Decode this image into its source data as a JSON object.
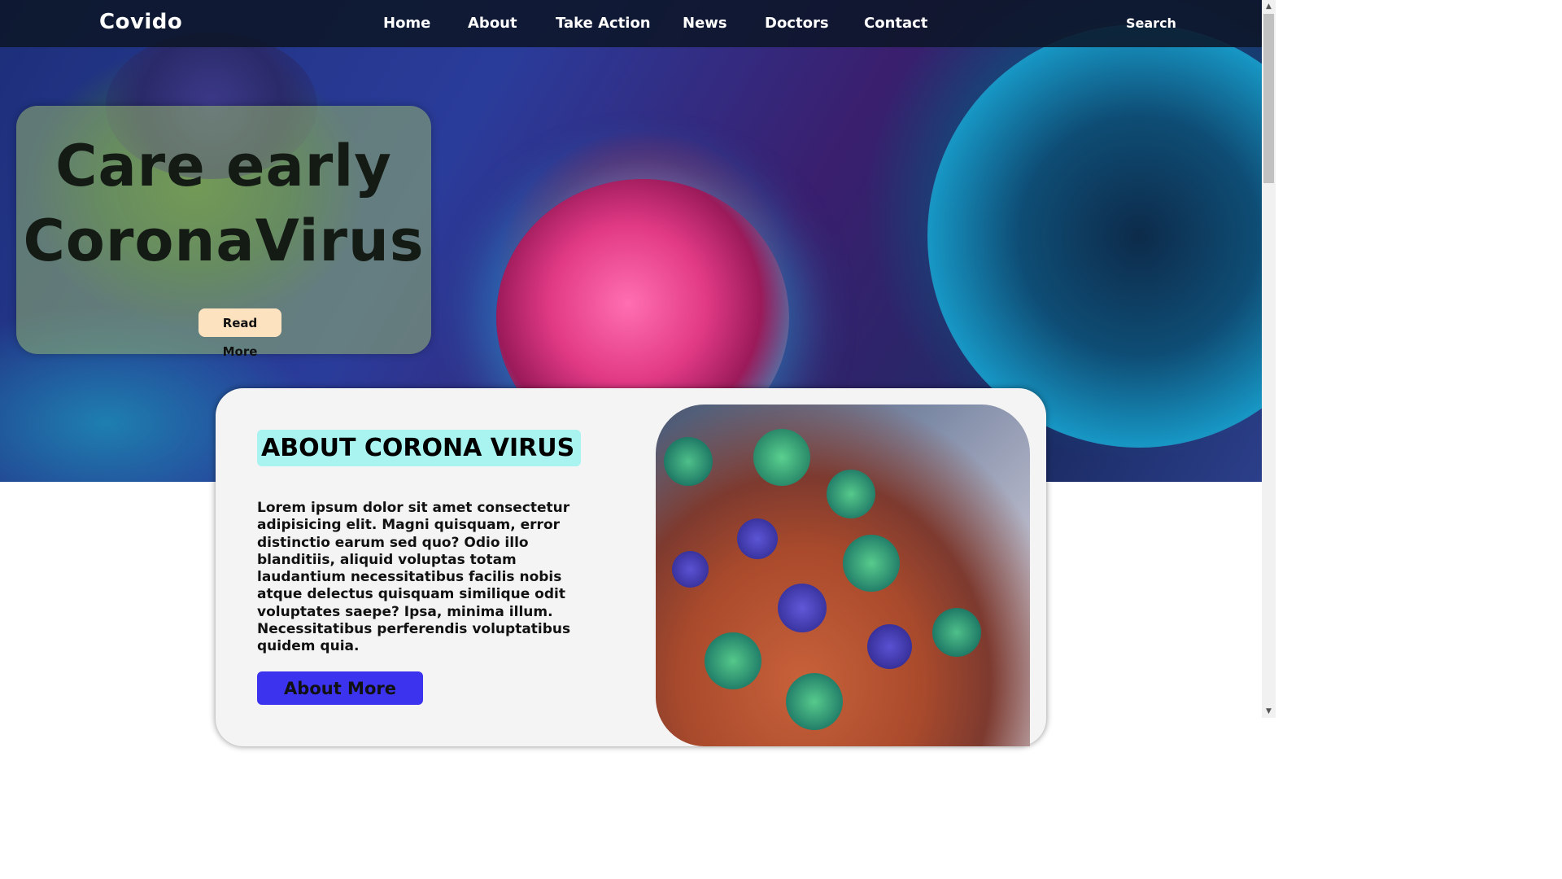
{
  "nav": {
    "brand": "Covido",
    "links": [
      "Home",
      "About",
      "Take Action",
      "News",
      "Doctors",
      "Contact"
    ],
    "search": "Search"
  },
  "hero": {
    "title_line1": "Care early",
    "title_line2": "CoronaVirus",
    "button": "Read More"
  },
  "about": {
    "heading": "ABOUT CORONA VIRUS",
    "text": "Lorem ipsum dolor sit amet consectetur adipisicing elit. Magni quisquam, error distinctio earum sed quo? Odio illo blanditiis, aliquid voluptas totam laudantium necessitatibus facilis nobis atque delectus quisquam similique odit voluptates saepe? Ipsa, minima illum. Necessitatibus perferendis voluptatibus quidem quia.",
    "button": "About More"
  },
  "colors": {
    "nav_bg": "#0c1628",
    "about_heading_bg": "#a9f3f1",
    "about_button_bg": "#3c33ee",
    "read_more_bg": "#fde2c0",
    "card_bg": "#f4f4f4"
  },
  "icons": [
    "scroll-up-arrow-icon",
    "scroll-down-arrow-icon"
  ]
}
